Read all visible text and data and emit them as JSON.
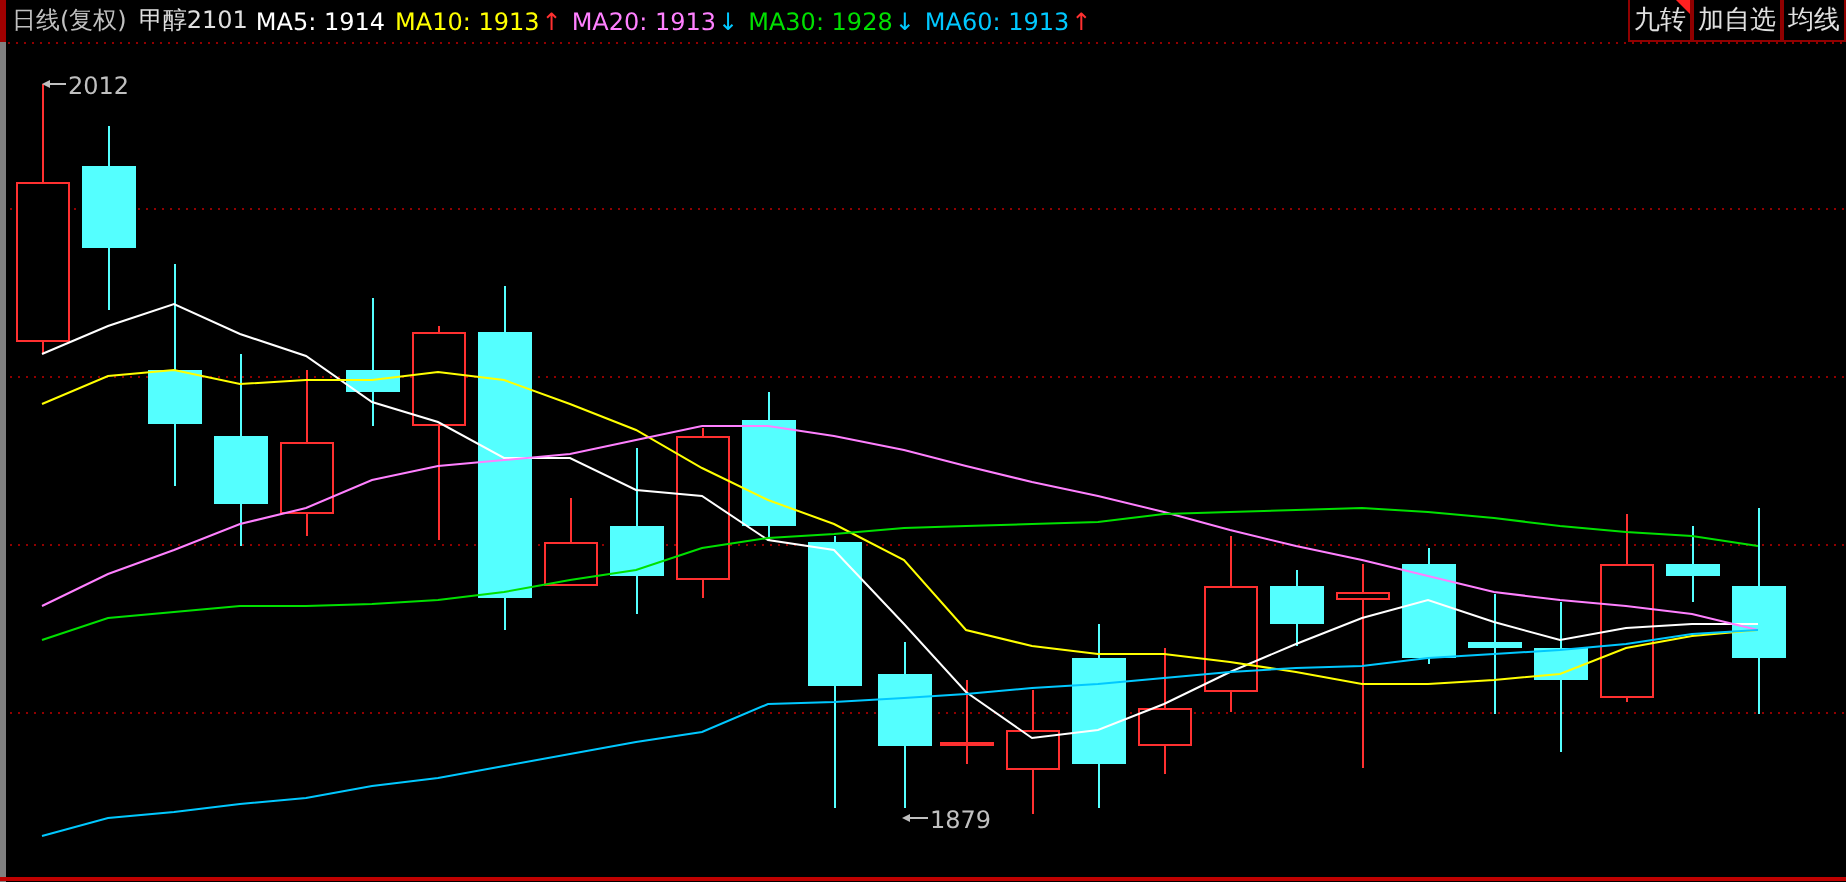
{
  "header": {
    "period": "日线(复权)",
    "symbol": "甲醇2101",
    "averages": [
      {
        "label": "MA5: 1914",
        "color": "#ffffff"
      },
      {
        "label": "MA10: 1913",
        "color": "#ffff00",
        "arrow": "↑",
        "kind": "rising"
      },
      {
        "label": "MA20: 1913",
        "color": "#ff80ff",
        "arrow": "↓",
        "kind": "falling"
      },
      {
        "label": "MA30: 1928",
        "color": "#00e000",
        "arrow": "↓",
        "kind": "falling"
      },
      {
        "label": "MA60: 1913",
        "color": "#00c8ff",
        "arrow": "↑",
        "kind": "rising"
      }
    ],
    "buttons": [
      {
        "label": "九转",
        "flagged": true
      },
      {
        "label": "加自选",
        "flagged": false
      },
      {
        "label": "均线",
        "flagged": false
      }
    ]
  },
  "chart": {
    "high_label": "2012",
    "low_label": "1879"
  }
}
